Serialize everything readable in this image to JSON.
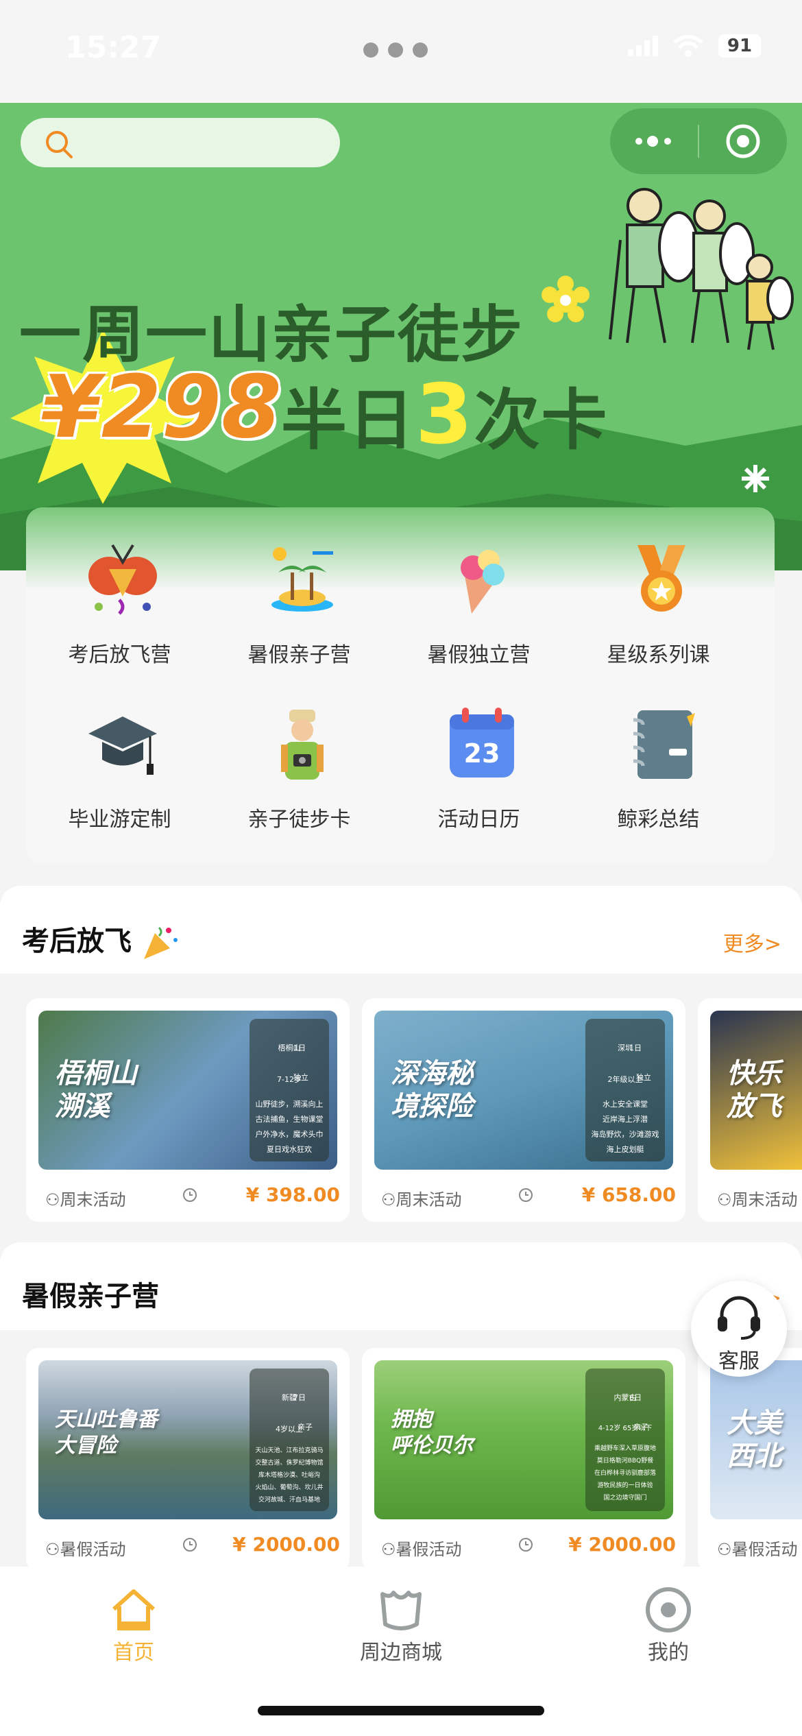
{
  "status_bar": {
    "time": "15:27",
    "battery": "91"
  },
  "banner": {
    "line1": "一周一山亲子徒步",
    "price": "¥298",
    "line2_a": "半日",
    "line2_b": "3",
    "line2_c": "次卡"
  },
  "menu": {
    "items": [
      {
        "label": "考后放飞营",
        "icon": "party-popper-icon"
      },
      {
        "label": "暑假亲子营",
        "icon": "island-icon"
      },
      {
        "label": "暑假独立营",
        "icon": "ice-cream-icon"
      },
      {
        "label": "星级系列课",
        "icon": "medal-icon"
      },
      {
        "label": "毕业游定制",
        "icon": "graduation-cap-icon"
      },
      {
        "label": "亲子徒步卡",
        "icon": "hiker-icon"
      },
      {
        "label": "活动日历",
        "icon": "calendar-icon",
        "calendar_day": "23"
      },
      {
        "label": "鲸彩总结",
        "icon": "notebook-icon"
      }
    ]
  },
  "sections": [
    {
      "title": "考后放飞",
      "more": "更多>",
      "cards": [
        {
          "title_l1": "梧桐山",
          "title_l2": "溯溪",
          "tag": "周末活动",
          "price": "¥ 398.00",
          "panel": {
            "place": "梧桐山",
            "days": "1日",
            "age": "7-12岁",
            "mode": "独立",
            "desc": [
              "山野徒步，溯溪向上",
              "古法捕鱼，生物课堂",
              "户外净水，魔术头巾",
              "夏日戏水狂欢"
            ]
          }
        },
        {
          "title_l1": "深海秘",
          "title_l2": "境探险",
          "tag": "周末活动",
          "price": "¥ 658.00",
          "panel": {
            "place": "深圳",
            "days": "1日",
            "age": "2年级以上",
            "mode": "独立",
            "desc": [
              "水上安全课堂",
              "近岸海上浮潜",
              "海岛野炊，沙滩游戏",
              "海上皮划艇"
            ]
          }
        },
        {
          "title_l1": "快乐",
          "title_l2": "放飞",
          "tag": "周末活动",
          "price": ""
        }
      ]
    },
    {
      "title": "暑假亲子营",
      "more": "更多>",
      "cards": [
        {
          "title_l1": "天山吐鲁番",
          "title_l2": "大冒险",
          "tag": "暑假活动",
          "price": "¥ 2000.00",
          "panel": {
            "place": "新疆",
            "days": "7日",
            "age": "4岁以上",
            "mode": "亲子",
            "desc": [
              "天山天池、江布拉克骑马",
              "交整古道、侏罗纪博物馆",
              "库木塔格沙漠、吐峪沟",
              "火焰山、葡萄沟、坎儿井",
              "交河故城、汗血马基地"
            ]
          }
        },
        {
          "title_l1": "拥抱",
          "title_l2": "呼伦贝尔",
          "tag": "暑假活动",
          "price": "¥ 2000.00",
          "panel": {
            "place": "内蒙古",
            "days": "6日",
            "age": "4-12岁 65岁以下",
            "mode": "亲子",
            "desc": [
              "乘越野车深入草原腹地",
              "莫日格勒河BBQ野餐",
              "在白桦林寻访驯鹿部落",
              "游牧民族的一日体验",
              "国之边境守国门"
            ]
          }
        },
        {
          "title_l1": "大美",
          "title_l2": "西北",
          "tag": "暑假活动",
          "price": ""
        }
      ]
    }
  ],
  "customer_service": {
    "label": "客服"
  },
  "tabbar": {
    "items": [
      {
        "label": "首页",
        "active": true
      },
      {
        "label": "周边商城",
        "active": false
      },
      {
        "label": "我的",
        "active": false
      }
    ]
  },
  "colors": {
    "brand_green": "#6cc46f",
    "accent_orange": "#f08a22",
    "tab_active": "#f5b335",
    "tab_inactive": "#9aa0a0"
  }
}
